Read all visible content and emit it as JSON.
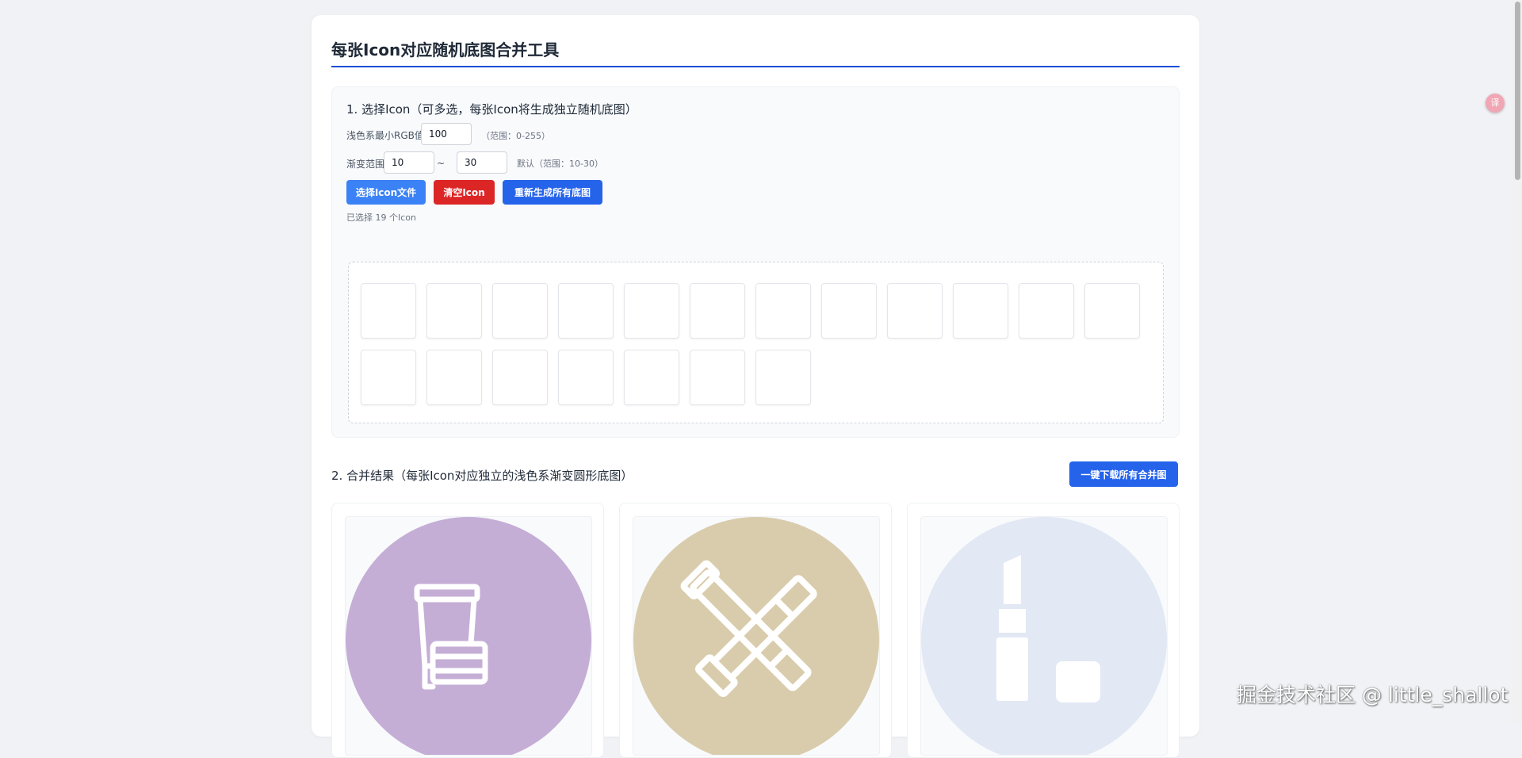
{
  "page": {
    "title": "每张Icon对应随机底图合并工具"
  },
  "section1": {
    "title": "1. 选择Icon（可多选，每张Icon将生成独立随机底图）",
    "min_rgb_label": "浅色系最小RGB值:",
    "min_rgb_value": "100",
    "min_rgb_hint": "（范围：0-255）",
    "gradient_label": "渐变范围",
    "gradient_min": "10",
    "gradient_separator": "~",
    "gradient_max": "30",
    "gradient_hint": "默认（范围：10-30）",
    "buttons": {
      "select": "选择Icon文件",
      "clear": "清空Icon",
      "regenerate": "重新生成所有底图"
    },
    "selected_count_text": "已选择 19 个Icon",
    "icon_count": 19
  },
  "section2": {
    "title": "2. 合并结果（每张Icon对应独立的浅色系渐变圆形底图）",
    "download_all": "一键下载所有合并图",
    "results": [
      {
        "icon": "cream-jar-icon",
        "color": "#c5aed5"
      },
      {
        "icon": "tube-crossed-icon",
        "color": "#d9ccac"
      },
      {
        "icon": "lipstick-icon",
        "color": "#e2e8f4"
      }
    ]
  },
  "overlay": {
    "translate_glyph": "译",
    "watermark": "掘金技术社区 @ little_shallot"
  }
}
